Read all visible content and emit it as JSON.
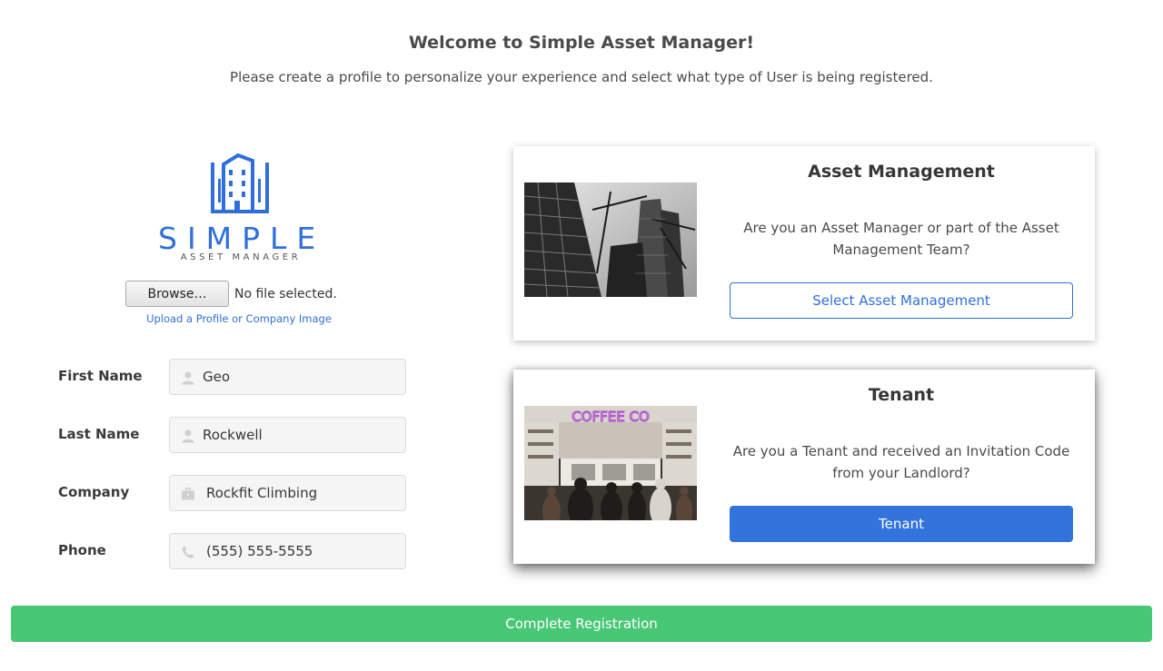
{
  "header": {
    "title": "Welcome to Simple Asset Manager!",
    "subtitle": "Please create a profile to personalize your experience and select what type of User is being registered."
  },
  "logo": {
    "word": "SIMPLE",
    "tagline": "ASSET MANAGER",
    "color": "#2f6fdc"
  },
  "upload": {
    "browse_label": "Browse…",
    "file_status": "No file selected.",
    "link_text": "Upload a Profile or Company Image"
  },
  "form": {
    "first_name": {
      "label": "First Name",
      "value": "Geo",
      "icon": "user-icon"
    },
    "last_name": {
      "label": "Last Name",
      "value": "Rockwell",
      "icon": "user-icon"
    },
    "company": {
      "label": "Company",
      "value": "Rockfit Climbing",
      "icon": "briefcase-icon"
    },
    "phone": {
      "label": "Phone",
      "value": "(555) 555-5555",
      "icon": "phone-icon"
    }
  },
  "cards": {
    "asset_management": {
      "title": "Asset Management",
      "text": "Are you an Asset Manager or part of the Asset Management Team?",
      "button": "Select Asset Management",
      "image": "construction-photo"
    },
    "tenant": {
      "title": "Tenant",
      "text": "Are you a Tenant and received an Invitation Code from your Landlord?",
      "button": "Tenant",
      "image": "coffee-shop-photo",
      "sign_text": "COFFEE CO"
    }
  },
  "complete_button": "Complete Registration",
  "colors": {
    "primary": "#3273dc",
    "success": "#48c774"
  }
}
